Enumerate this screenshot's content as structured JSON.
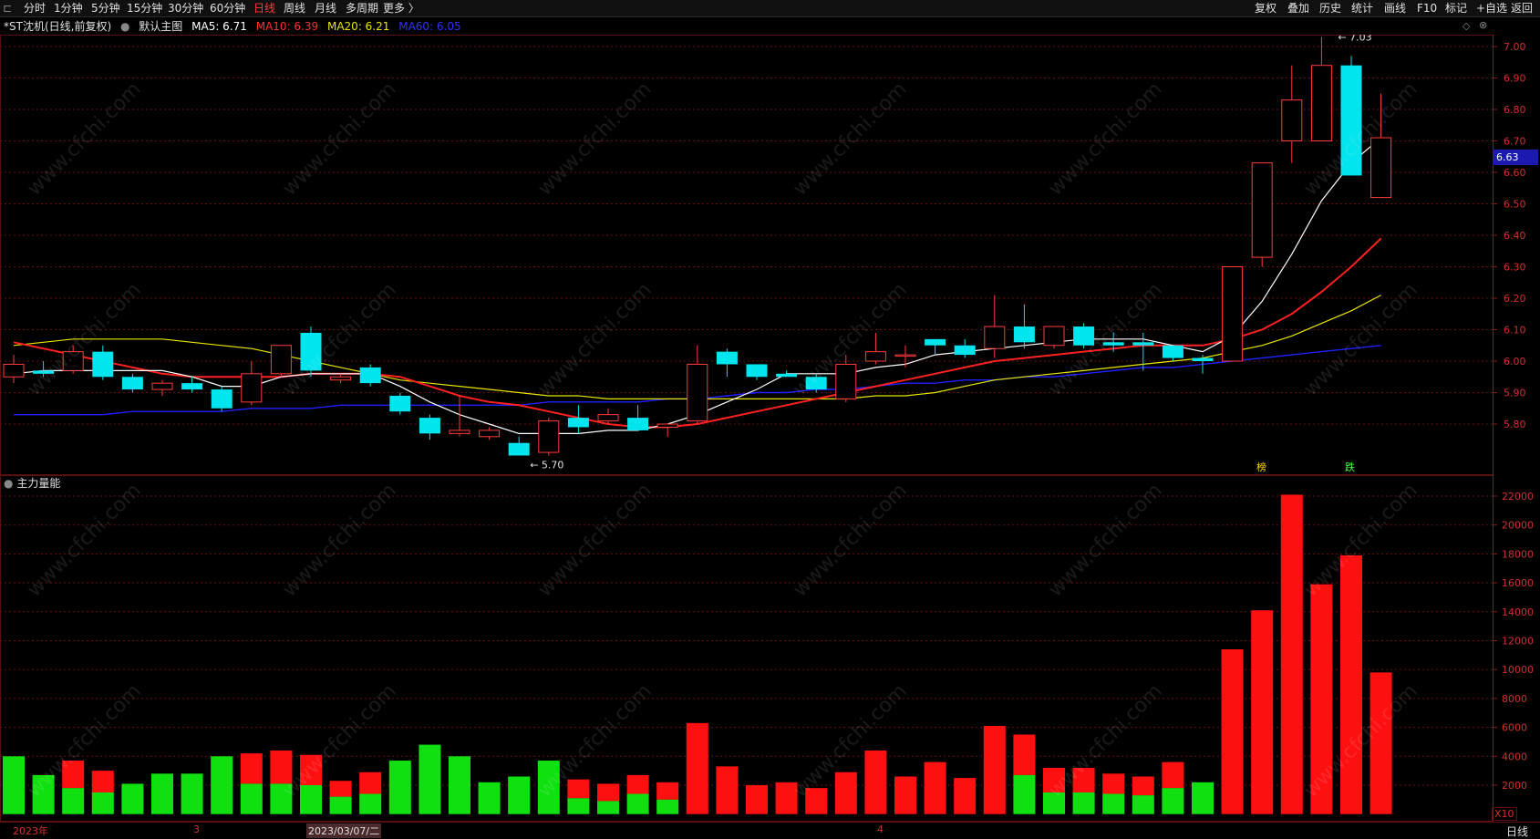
{
  "toolbar": {
    "left_items": [
      "分时",
      "1分钟",
      "5分钟",
      "15分钟",
      "30分钟",
      "60分钟",
      "日线",
      "周线",
      "月线",
      "多周期",
      "更多 〉"
    ],
    "active_index": 6,
    "right_items": [
      "复权",
      "叠加",
      "历史",
      "统计",
      "画线",
      "F10",
      "标记",
      "+自选",
      "返回"
    ]
  },
  "price_panel": {
    "title": "*ST沈机(日线,前复权)",
    "main_label": "默认主图",
    "ma5_label": "MA5: 6.71",
    "ma10_label": "MA10: 6.39",
    "ma20_label": "MA20: 6.21",
    "ma60_label": "MA60: 6.05",
    "current_price": "6.63",
    "high_marker": "7.03",
    "low_marker": "5.70",
    "badges": [
      "榜",
      "跌"
    ],
    "colors": {
      "up": "#ff3b3b",
      "down": "#00e5ee",
      "ma5": "#ffffff",
      "ma10": "#ff2020",
      "ma20": "#e6e600",
      "ma60": "#2020ff"
    }
  },
  "volume_panel": {
    "title": "主力量能"
  },
  "bottom": {
    "dates": [
      "2023年",
      "3",
      "2023/03/07/二",
      "4"
    ],
    "period": "日线",
    "x10": "X10"
  },
  "watermark": "www.cfchi.com",
  "chart_data": [
    {
      "type": "candlestick",
      "title": "*ST沈机(日线,前复权)",
      "yticks": [
        5.8,
        5.9,
        6.0,
        6.1,
        6.2,
        6.3,
        6.4,
        6.5,
        6.6,
        6.7,
        6.8,
        6.9,
        7.0
      ],
      "ylim": [
        5.7,
        7.03
      ],
      "candles": [
        {
          "o": 5.95,
          "h": 6.02,
          "l": 5.93,
          "c": 5.99
        },
        {
          "o": 5.97,
          "h": 6.0,
          "l": 5.95,
          "c": 5.96
        },
        {
          "o": 5.97,
          "h": 6.05,
          "l": 5.96,
          "c": 6.03
        },
        {
          "o": 6.03,
          "h": 6.05,
          "l": 5.94,
          "c": 5.95
        },
        {
          "o": 5.95,
          "h": 5.96,
          "l": 5.9,
          "c": 5.91
        },
        {
          "o": 5.91,
          "h": 5.94,
          "l": 5.89,
          "c": 5.93
        },
        {
          "o": 5.93,
          "h": 5.95,
          "l": 5.9,
          "c": 5.91
        },
        {
          "o": 5.91,
          "h": 5.92,
          "l": 5.84,
          "c": 5.85
        },
        {
          "o": 5.87,
          "h": 6.0,
          "l": 5.86,
          "c": 5.96
        },
        {
          "o": 5.96,
          "h": 6.05,
          "l": 5.95,
          "c": 6.05
        },
        {
          "o": 6.09,
          "h": 6.11,
          "l": 5.95,
          "c": 5.97
        },
        {
          "o": 5.94,
          "h": 5.96,
          "l": 5.93,
          "c": 5.95
        },
        {
          "o": 5.98,
          "h": 5.99,
          "l": 5.92,
          "c": 5.93
        },
        {
          "o": 5.89,
          "h": 5.9,
          "l": 5.83,
          "c": 5.84
        },
        {
          "o": 5.82,
          "h": 5.83,
          "l": 5.75,
          "c": 5.77
        },
        {
          "o": 5.77,
          "h": 5.89,
          "l": 5.76,
          "c": 5.78
        },
        {
          "o": 5.76,
          "h": 5.79,
          "l": 5.75,
          "c": 5.78
        },
        {
          "o": 5.74,
          "h": 5.76,
          "l": 5.7,
          "c": 5.7
        },
        {
          "o": 5.71,
          "h": 5.82,
          "l": 5.7,
          "c": 5.81
        },
        {
          "o": 5.82,
          "h": 5.86,
          "l": 5.77,
          "c": 5.79
        },
        {
          "o": 5.81,
          "h": 5.85,
          "l": 5.8,
          "c": 5.83
        },
        {
          "o": 5.82,
          "h": 5.86,
          "l": 5.79,
          "c": 5.78
        },
        {
          "o": 5.79,
          "h": 5.8,
          "l": 5.76,
          "c": 5.8
        },
        {
          "o": 5.81,
          "h": 6.05,
          "l": 5.8,
          "c": 5.99
        },
        {
          "o": 6.03,
          "h": 6.04,
          "l": 5.95,
          "c": 5.99
        },
        {
          "o": 5.99,
          "h": 5.99,
          "l": 5.94,
          "c": 5.95
        },
        {
          "o": 5.96,
          "h": 5.97,
          "l": 5.95,
          "c": 5.95
        },
        {
          "o": 5.95,
          "h": 5.96,
          "l": 5.9,
          "c": 5.91
        },
        {
          "o": 5.88,
          "h": 6.02,
          "l": 5.87,
          "c": 5.99
        },
        {
          "o": 6.0,
          "h": 6.09,
          "l": 5.99,
          "c": 6.03
        },
        {
          "o": 6.02,
          "h": 6.05,
          "l": 5.98,
          "c": 6.02
        },
        {
          "o": 6.07,
          "h": 6.07,
          "l": 6.02,
          "c": 6.05
        },
        {
          "o": 6.05,
          "h": 6.07,
          "l": 6.01,
          "c": 6.02
        },
        {
          "o": 6.04,
          "h": 6.21,
          "l": 6.01,
          "c": 6.11
        },
        {
          "o": 6.11,
          "h": 6.18,
          "l": 6.04,
          "c": 6.06
        },
        {
          "o": 6.05,
          "h": 6.11,
          "l": 6.04,
          "c": 6.11
        },
        {
          "o": 6.11,
          "h": 6.12,
          "l": 6.04,
          "c": 6.05
        },
        {
          "o": 6.06,
          "h": 6.09,
          "l": 6.03,
          "c": 6.05
        },
        {
          "o": 6.06,
          "h": 6.09,
          "l": 5.97,
          "c": 6.05
        },
        {
          "o": 6.05,
          "h": 6.05,
          "l": 6.0,
          "c": 6.01
        },
        {
          "o": 6.01,
          "h": 6.02,
          "l": 5.96,
          "c": 6.0
        },
        {
          "o": 6.0,
          "h": 6.3,
          "l": 6.0,
          "c": 6.3
        },
        {
          "o": 6.33,
          "h": 6.63,
          "l": 6.3,
          "c": 6.63
        },
        {
          "o": 6.7,
          "h": 6.94,
          "l": 6.63,
          "c": 6.83
        },
        {
          "o": 6.7,
          "h": 7.03,
          "l": 6.7,
          "c": 6.94
        },
        {
          "o": 6.94,
          "h": 6.97,
          "l": 6.59,
          "c": 6.59
        },
        {
          "o": 6.52,
          "h": 6.85,
          "l": 6.52,
          "c": 6.71
        }
      ],
      "ma5": [
        5.96,
        5.97,
        5.97,
        5.97,
        5.97,
        5.97,
        5.95,
        5.92,
        5.92,
        5.95,
        5.96,
        5.96,
        5.96,
        5.92,
        5.87,
        5.83,
        5.8,
        5.77,
        5.77,
        5.77,
        5.78,
        5.78,
        5.8,
        5.83,
        5.87,
        5.91,
        5.96,
        5.96,
        5.96,
        5.98,
        5.99,
        6.02,
        6.03,
        6.04,
        6.05,
        6.06,
        6.07,
        6.07,
        6.07,
        6.05,
        6.03,
        6.08,
        6.19,
        6.34,
        6.51,
        6.63,
        6.71
      ],
      "ma10": [
        6.06,
        6.04,
        6.02,
        6.0,
        5.98,
        5.96,
        5.95,
        5.95,
        5.95,
        5.95,
        5.96,
        5.96,
        5.96,
        5.95,
        5.92,
        5.89,
        5.87,
        5.86,
        5.84,
        5.82,
        5.8,
        5.79,
        5.79,
        5.8,
        5.82,
        5.84,
        5.86,
        5.88,
        5.9,
        5.92,
        5.94,
        5.96,
        5.98,
        6.0,
        6.01,
        6.02,
        6.03,
        6.04,
        6.05,
        6.05,
        6.05,
        6.07,
        6.1,
        6.15,
        6.22,
        6.3,
        6.39
      ],
      "ma20": [
        6.05,
        6.06,
        6.07,
        6.07,
        6.07,
        6.07,
        6.06,
        6.05,
        6.04,
        6.02,
        6.0,
        5.98,
        5.96,
        5.94,
        5.93,
        5.92,
        5.91,
        5.9,
        5.89,
        5.89,
        5.88,
        5.88,
        5.88,
        5.88,
        5.88,
        5.88,
        5.88,
        5.88,
        5.88,
        5.89,
        5.89,
        5.9,
        5.92,
        5.94,
        5.95,
        5.96,
        5.97,
        5.98,
        5.99,
        6.0,
        6.01,
        6.03,
        6.05,
        6.08,
        6.12,
        6.16,
        6.21
      ],
      "ma60": [
        5.83,
        5.83,
        5.83,
        5.83,
        5.84,
        5.84,
        5.84,
        5.84,
        5.85,
        5.85,
        5.85,
        5.86,
        5.86,
        5.86,
        5.86,
        5.86,
        5.86,
        5.86,
        5.87,
        5.87,
        5.87,
        5.87,
        5.88,
        5.88,
        5.89,
        5.9,
        5.9,
        5.91,
        5.91,
        5.92,
        5.93,
        5.93,
        5.94,
        5.94,
        5.95,
        5.95,
        5.96,
        5.97,
        5.98,
        5.98,
        5.99,
        6.0,
        6.01,
        6.02,
        6.03,
        6.04,
        6.05
      ]
    },
    {
      "type": "bar",
      "title": "主力量能",
      "yticks": [
        2000,
        4000,
        6000,
        8000,
        10000,
        12000,
        14000,
        16000,
        18000,
        20000,
        22000
      ],
      "ylim": [
        0,
        22000
      ],
      "total": [
        4000,
        2700,
        3700,
        3000,
        2100,
        2800,
        2800,
        4000,
        4200,
        4400,
        4100,
        2300,
        2900,
        3700,
        4800,
        4000,
        2200,
        2600,
        3700,
        2400,
        2100,
        2700,
        2200,
        6300,
        3300,
        2000,
        2200,
        1800,
        2900,
        4400,
        2600,
        3600,
        2500,
        6100,
        5500,
        3200,
        3200,
        2800,
        2600,
        3600,
        2200,
        11400,
        14100,
        22100,
        15900,
        17900,
        9800
      ],
      "green": [
        4000,
        2700,
        1800,
        1500,
        2100,
        2800,
        2800,
        4000,
        2100,
        2100,
        2000,
        1200,
        1400,
        3700,
        4800,
        4000,
        2200,
        2600,
        3700,
        1100,
        900,
        1400,
        1000,
        0,
        0,
        0,
        0,
        0,
        0,
        0,
        0,
        0,
        0,
        0,
        2700,
        1500,
        1500,
        1400,
        1300,
        1800,
        2200,
        0,
        0,
        0,
        0,
        0,
        0
      ]
    }
  ]
}
